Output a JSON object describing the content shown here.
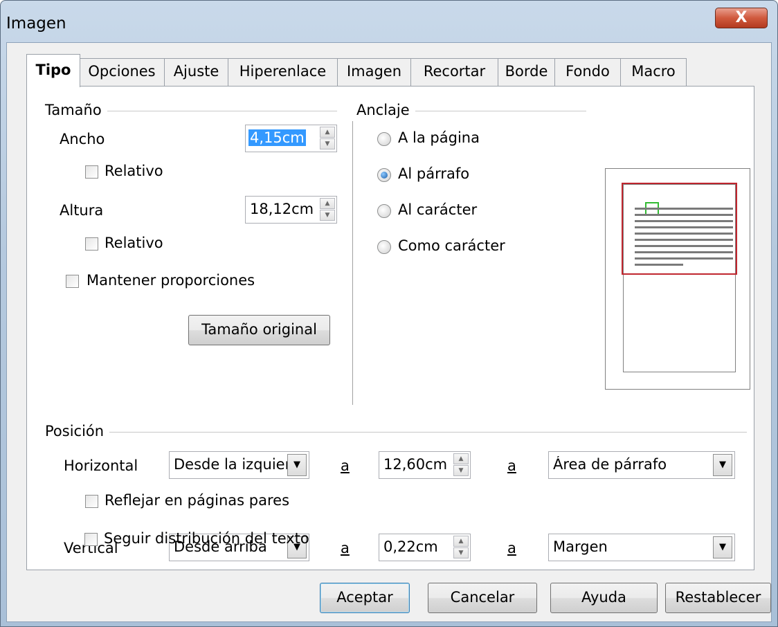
{
  "window": {
    "title": "Imagen",
    "close_glyph": "X"
  },
  "tabs": [
    "Tipo",
    "Opciones",
    "Ajuste",
    "Hiperenlace",
    "Imagen",
    "Recortar",
    "Borde",
    "Fondo",
    "Macro"
  ],
  "size": {
    "group": "Tamaño",
    "width_label": "Ancho",
    "width_value": "4,15cm",
    "width_relative": "Relativo",
    "height_label": "Altura",
    "height_value": "18,12cm",
    "height_relative": "Relativo",
    "keep_ratio": "Mantener proporciones",
    "original_size_button": "Tamaño original"
  },
  "anchor": {
    "group": "Anclaje",
    "options": [
      "A la página",
      "Al párrafo",
      "Al carácter",
      "Como carácter"
    ],
    "selected": "Al párrafo"
  },
  "position": {
    "group": "Posición",
    "horizontal_label": "Horizontal",
    "horizontal_from": "Desde la izquierda",
    "to_label": "a",
    "horizontal_value": "12,60cm",
    "horizontal_to": "Área de párrafo",
    "mirror": "Reflejar en páginas pares",
    "vertical_label": "Vertical",
    "vertical_from": "Desde arriba",
    "vertical_value": "0,22cm",
    "vertical_to": "Margen",
    "follow_flow": "Seguir distribución del texto"
  },
  "buttons": {
    "ok": "Aceptar",
    "cancel": "Cancelar",
    "help": "Ayuda",
    "reset": "Restablecer"
  },
  "icons": {
    "spin_up": "▲",
    "spin_down": "▼",
    "dropdown": "▼"
  },
  "colors": {
    "selection": "#3399ff",
    "anchor_area": "#c0262e",
    "frame": "#33bb33"
  }
}
